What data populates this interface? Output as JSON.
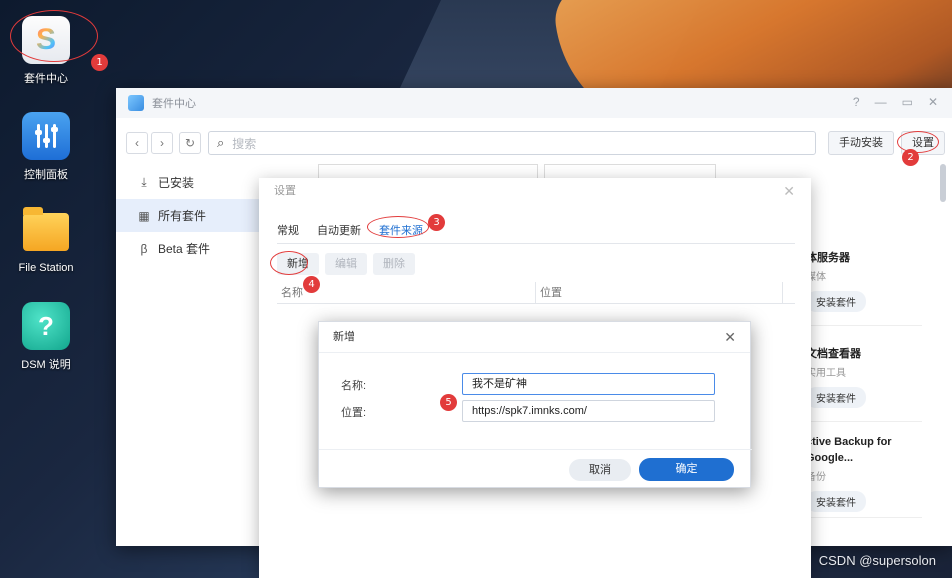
{
  "desktop": {
    "icons": [
      {
        "label": "套件中心"
      },
      {
        "label": "控制面板"
      },
      {
        "label": "File Station"
      },
      {
        "label": "DSM 说明"
      }
    ]
  },
  "annotations": [
    "1",
    "2",
    "3",
    "4",
    "5"
  ],
  "window": {
    "title": "套件中心",
    "controls": [
      "?",
      "—",
      "▭",
      "✕"
    ],
    "toolbar": {
      "search_placeholder": "搜索",
      "manual_install": "手动安装",
      "settings": "设置"
    },
    "sidebar": [
      {
        "label": "已安装",
        "icon": "download-icon"
      },
      {
        "label": "所有套件",
        "icon": "grid-icon"
      },
      {
        "label": "Beta 套件",
        "icon": "beta-icon"
      }
    ],
    "bg_cards": [
      {
        "title": "体服务器",
        "subtitle": "媒体",
        "button": "安装套件"
      },
      {
        "title": "文档查看器",
        "subtitle": "实用工具",
        "button": "安装套件"
      },
      {
        "title": "ctive Backup for Google...",
        "subtitle": "备份",
        "button": "安装套件"
      }
    ]
  },
  "settings_dialog": {
    "title": "设置",
    "tabs": [
      "常规",
      "自动更新",
      "套件来源"
    ],
    "actions": {
      "add": "新增",
      "edit": "编辑",
      "delete": "删除"
    },
    "columns": [
      "名称",
      "位置"
    ]
  },
  "add_dialog": {
    "title": "新增",
    "name_label": "名称:",
    "name_value": "我不是矿神",
    "location_label": "位置:",
    "location_value": "https://spk7.imnks.com/",
    "cancel": "取消",
    "ok": "确定"
  },
  "watermark": "CSDN @supersolon",
  "colors": {
    "accent": "#1f6fd1",
    "annotation": "#e23b3b"
  }
}
